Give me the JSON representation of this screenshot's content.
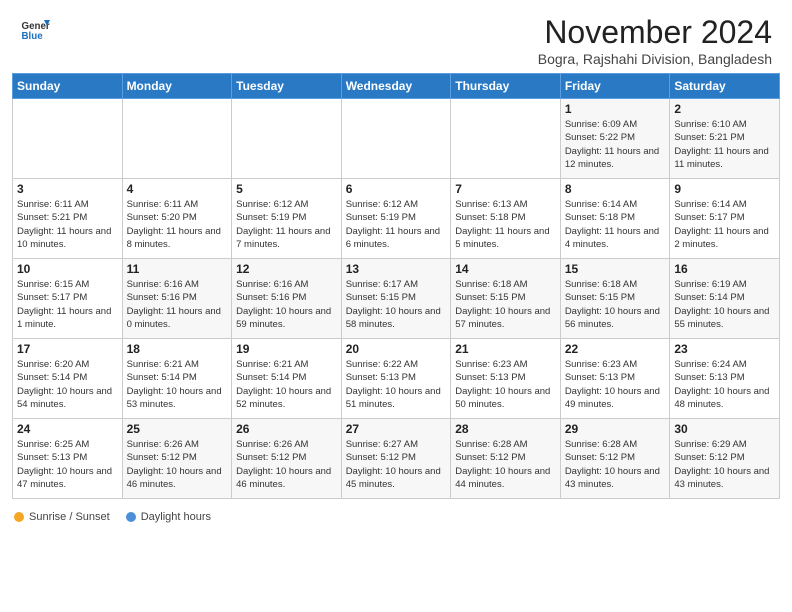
{
  "header": {
    "logo_general": "General",
    "logo_blue": "Blue",
    "month_title": "November 2024",
    "subtitle": "Bogra, Rajshahi Division, Bangladesh"
  },
  "weekdays": [
    "Sunday",
    "Monday",
    "Tuesday",
    "Wednesday",
    "Thursday",
    "Friday",
    "Saturday"
  ],
  "weeks": [
    [
      {
        "day": "",
        "info": ""
      },
      {
        "day": "",
        "info": ""
      },
      {
        "day": "",
        "info": ""
      },
      {
        "day": "",
        "info": ""
      },
      {
        "day": "",
        "info": ""
      },
      {
        "day": "1",
        "info": "Sunrise: 6:09 AM\nSunset: 5:22 PM\nDaylight: 11 hours and 12 minutes."
      },
      {
        "day": "2",
        "info": "Sunrise: 6:10 AM\nSunset: 5:21 PM\nDaylight: 11 hours and 11 minutes."
      }
    ],
    [
      {
        "day": "3",
        "info": "Sunrise: 6:11 AM\nSunset: 5:21 PM\nDaylight: 11 hours and 10 minutes."
      },
      {
        "day": "4",
        "info": "Sunrise: 6:11 AM\nSunset: 5:20 PM\nDaylight: 11 hours and 8 minutes."
      },
      {
        "day": "5",
        "info": "Sunrise: 6:12 AM\nSunset: 5:19 PM\nDaylight: 11 hours and 7 minutes."
      },
      {
        "day": "6",
        "info": "Sunrise: 6:12 AM\nSunset: 5:19 PM\nDaylight: 11 hours and 6 minutes."
      },
      {
        "day": "7",
        "info": "Sunrise: 6:13 AM\nSunset: 5:18 PM\nDaylight: 11 hours and 5 minutes."
      },
      {
        "day": "8",
        "info": "Sunrise: 6:14 AM\nSunset: 5:18 PM\nDaylight: 11 hours and 4 minutes."
      },
      {
        "day": "9",
        "info": "Sunrise: 6:14 AM\nSunset: 5:17 PM\nDaylight: 11 hours and 2 minutes."
      }
    ],
    [
      {
        "day": "10",
        "info": "Sunrise: 6:15 AM\nSunset: 5:17 PM\nDaylight: 11 hours and 1 minute."
      },
      {
        "day": "11",
        "info": "Sunrise: 6:16 AM\nSunset: 5:16 PM\nDaylight: 11 hours and 0 minutes."
      },
      {
        "day": "12",
        "info": "Sunrise: 6:16 AM\nSunset: 5:16 PM\nDaylight: 10 hours and 59 minutes."
      },
      {
        "day": "13",
        "info": "Sunrise: 6:17 AM\nSunset: 5:15 PM\nDaylight: 10 hours and 58 minutes."
      },
      {
        "day": "14",
        "info": "Sunrise: 6:18 AM\nSunset: 5:15 PM\nDaylight: 10 hours and 57 minutes."
      },
      {
        "day": "15",
        "info": "Sunrise: 6:18 AM\nSunset: 5:15 PM\nDaylight: 10 hours and 56 minutes."
      },
      {
        "day": "16",
        "info": "Sunrise: 6:19 AM\nSunset: 5:14 PM\nDaylight: 10 hours and 55 minutes."
      }
    ],
    [
      {
        "day": "17",
        "info": "Sunrise: 6:20 AM\nSunset: 5:14 PM\nDaylight: 10 hours and 54 minutes."
      },
      {
        "day": "18",
        "info": "Sunrise: 6:21 AM\nSunset: 5:14 PM\nDaylight: 10 hours and 53 minutes."
      },
      {
        "day": "19",
        "info": "Sunrise: 6:21 AM\nSunset: 5:14 PM\nDaylight: 10 hours and 52 minutes."
      },
      {
        "day": "20",
        "info": "Sunrise: 6:22 AM\nSunset: 5:13 PM\nDaylight: 10 hours and 51 minutes."
      },
      {
        "day": "21",
        "info": "Sunrise: 6:23 AM\nSunset: 5:13 PM\nDaylight: 10 hours and 50 minutes."
      },
      {
        "day": "22",
        "info": "Sunrise: 6:23 AM\nSunset: 5:13 PM\nDaylight: 10 hours and 49 minutes."
      },
      {
        "day": "23",
        "info": "Sunrise: 6:24 AM\nSunset: 5:13 PM\nDaylight: 10 hours and 48 minutes."
      }
    ],
    [
      {
        "day": "24",
        "info": "Sunrise: 6:25 AM\nSunset: 5:13 PM\nDaylight: 10 hours and 47 minutes."
      },
      {
        "day": "25",
        "info": "Sunrise: 6:26 AM\nSunset: 5:12 PM\nDaylight: 10 hours and 46 minutes."
      },
      {
        "day": "26",
        "info": "Sunrise: 6:26 AM\nSunset: 5:12 PM\nDaylight: 10 hours and 46 minutes."
      },
      {
        "day": "27",
        "info": "Sunrise: 6:27 AM\nSunset: 5:12 PM\nDaylight: 10 hours and 45 minutes."
      },
      {
        "day": "28",
        "info": "Sunrise: 6:28 AM\nSunset: 5:12 PM\nDaylight: 10 hours and 44 minutes."
      },
      {
        "day": "29",
        "info": "Sunrise: 6:28 AM\nSunset: 5:12 PM\nDaylight: 10 hours and 43 minutes."
      },
      {
        "day": "30",
        "info": "Sunrise: 6:29 AM\nSunset: 5:12 PM\nDaylight: 10 hours and 43 minutes."
      }
    ]
  ],
  "legend": {
    "sunrise_label": "Sunrise / Sunset",
    "daylight_label": "Daylight hours",
    "sunrise_color": "#f5a623",
    "daylight_color": "#4a90d9"
  }
}
